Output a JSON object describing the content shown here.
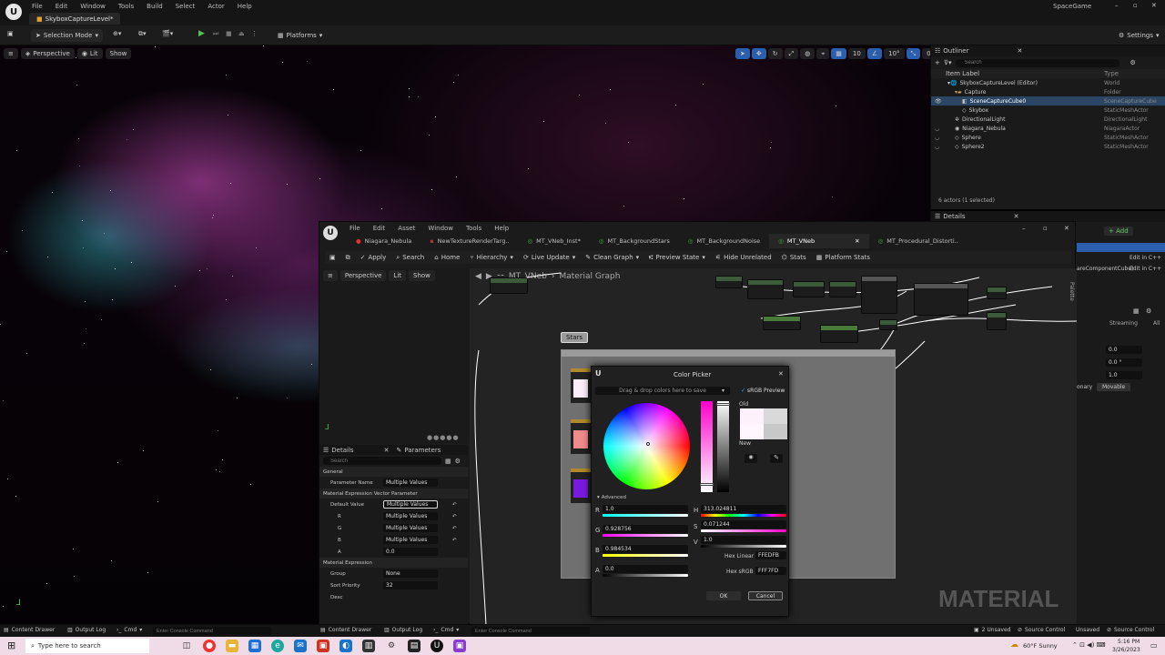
{
  "app": {
    "tab_title": "SkyboxCaptureLevel*",
    "project": "SpaceGame",
    "menu": [
      "File",
      "Edit",
      "Window",
      "Tools",
      "Build",
      "Select",
      "Actor",
      "Help"
    ],
    "selection_mode": "Selection Mode",
    "platforms": "Platforms",
    "settings": "Settings"
  },
  "viewport": {
    "perspective": "Perspective",
    "lit": "Lit",
    "show": "Show",
    "snap_values": [
      "10",
      "10°",
      "0.25",
      "2"
    ]
  },
  "outliner": {
    "title": "Outliner",
    "search_placeholder": "Search",
    "col_label": "Item Label",
    "col_type": "Type",
    "rows": [
      {
        "label": "SkyboxCaptureLevel (Editor)",
        "type": "World"
      },
      {
        "label": "Capture",
        "type": "Folder"
      },
      {
        "label": "SceneCaptureCube0",
        "type": "SceneCaptureCube"
      },
      {
        "label": "Skybox",
        "type": "StaticMeshActor"
      },
      {
        "label": "DirectionalLight",
        "type": "DirectionalLight"
      },
      {
        "label": "Niagara_Nebula",
        "type": "NiagaraActor"
      },
      {
        "label": "Sphere",
        "type": "StaticMeshActor"
      },
      {
        "label": "Sphere2",
        "type": "StaticMeshActor"
      }
    ],
    "footer": "6 actors (1 selected)"
  },
  "details_right": {
    "title": "Details",
    "add": "+ Add",
    "edit_cpp": "Edit in C++",
    "component": "areComponentCube)",
    "streaming": "Streaming",
    "all": "All",
    "values": [
      "0.0",
      "0.0 °",
      "1.0"
    ],
    "stationary": "onary",
    "movable": "Movable"
  },
  "material_editor": {
    "menu": [
      "File",
      "Edit",
      "Asset",
      "Window",
      "Tools",
      "Help"
    ],
    "tabs": [
      "Niagara_Nebula",
      "NewTextureRenderTarg..",
      "MT_VNeb_Inst*",
      "MT_BackgroundStars",
      "MT_BackgroundNoise",
      "MT_VNeb",
      "MT_Procedural_Distorti.."
    ],
    "toolbar": [
      "Apply",
      "Search",
      "Home",
      "Hierarchy",
      "Live Update",
      "Clean Graph",
      "Preview State",
      "Hide Unrelated",
      "Stats",
      "Platform Stats"
    ],
    "viewport": {
      "perspective": "Perspective",
      "lit": "Lit",
      "show": "Show"
    },
    "breadcrumb": {
      "asset": "MT_VNeb",
      "graph": "Material Graph"
    },
    "palette": "Palette",
    "comment": "Stars",
    "watermark": "MATERIAL",
    "details": {
      "tab_details": "Details",
      "tab_parameters": "Parameters",
      "search_placeholder": "Search",
      "section_general": "General",
      "param_name_label": "Parameter Name",
      "param_name_value": "Multiple Values",
      "section_vector": "Material Expression Vector Parameter",
      "default_value_label": "Default Value",
      "default_value": "Multiple Values",
      "r": "Multiple Values",
      "g": "Multiple Values",
      "b": "Multiple Values",
      "a": "0.0",
      "section_expression": "Material Expression",
      "group_label": "Group",
      "group_value": "None",
      "sort_label": "Sort Priority",
      "sort_value": "32",
      "desc_label": "Desc"
    }
  },
  "color_picker": {
    "title": "Color Picker",
    "drag_hint": "Drag & drop colors here to save",
    "srgb_preview": "sRGB Preview",
    "old_label": "Old",
    "new_label": "New",
    "advanced": "Advanced",
    "r": "1.0",
    "g": "0.928756",
    "b": "0.984534",
    "a": "0.0",
    "h": "313.024811",
    "s": "0.071244",
    "v": "1.0",
    "hex_linear_label": "Hex Linear",
    "hex_linear": "FFEDFB",
    "hex_srgb_label": "Hex sRGB",
    "hex_srgb": "FFF7FD",
    "ok": "OK",
    "cancel": "Cancel"
  },
  "statusbar": {
    "content_drawer": "Content Drawer",
    "output_log": "Output Log",
    "cmd": "Cmd",
    "console_placeholder": "Enter Console Command",
    "unsaved": "2 Unsaved",
    "source_control": "Source Control",
    "unsaved2": "Unsaved",
    "source_control2": "Source Control"
  },
  "taskbar": {
    "search_placeholder": "Type here to search",
    "weather": "60°F  Sunny",
    "time": "5:16 PM",
    "date": "3/26/2023"
  }
}
